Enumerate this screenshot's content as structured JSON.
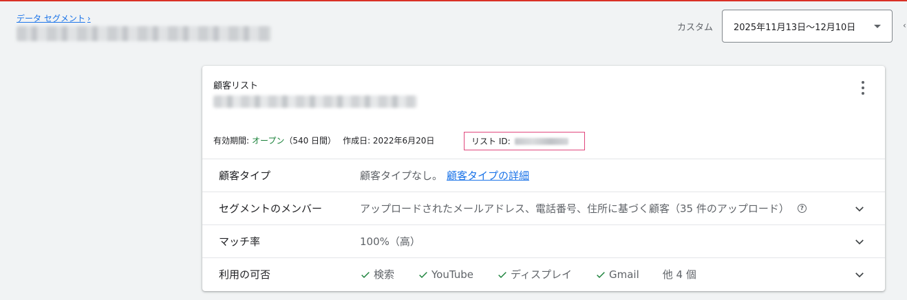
{
  "breadcrumb": {
    "label": "データ セグメント",
    "chevron": "›"
  },
  "date": {
    "range_label": "カスタム",
    "selected": "2025年11月13日〜12月10日",
    "edge_arrow": "‹"
  },
  "card": {
    "kicker": "顧客リスト",
    "meta": {
      "period_label": "有効期間:",
      "period_status": "オープン",
      "period_days": "（540 日間）",
      "created": "作成日: 2022年6月20日",
      "list_id_label": "リスト ID:"
    },
    "rows": [
      {
        "label": "顧客タイプ",
        "text": "顧客タイプなし。",
        "link": "顧客タイプの詳細"
      },
      {
        "label": "セグメントのメンバー",
        "text": "アップロードされたメールアドレス、電話番号、住所に基づく顧客（35 件のアップロード）",
        "help_icon": "?"
      },
      {
        "label": "マッチ率",
        "text": "100%（高）"
      },
      {
        "label": "利用の可否",
        "items": [
          "検索",
          "YouTube",
          "ディスプレイ",
          "Gmail"
        ],
        "others": "他 4 個"
      }
    ]
  },
  "colors": {
    "accent": "#1a73e8",
    "green": "#188038",
    "highlight": "#e0457b",
    "top_bar": "#d93025"
  },
  "icons": [
    "chevron-right-icon",
    "caret-down-icon",
    "more-vert-icon",
    "help-icon",
    "check-icon",
    "chevron-down-icon"
  ]
}
